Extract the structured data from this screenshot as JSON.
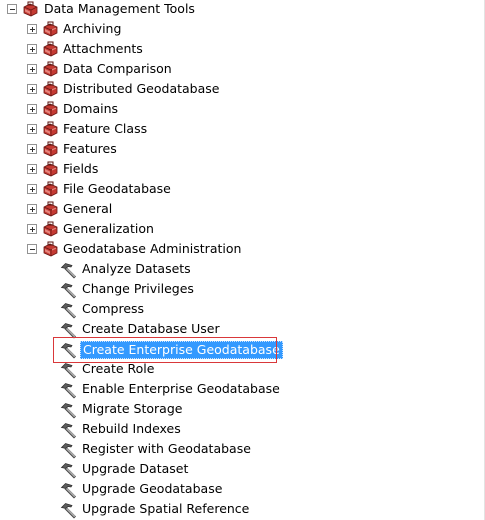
{
  "tree": {
    "root": {
      "label": "Data Management Tools",
      "expanded": true,
      "icon": "toolbox-icon"
    },
    "toolsets": [
      {
        "label": "Archiving",
        "expanded": false,
        "icon": "toolbox-icon"
      },
      {
        "label": "Attachments",
        "expanded": false,
        "icon": "toolbox-icon"
      },
      {
        "label": "Data Comparison",
        "expanded": false,
        "icon": "toolbox-icon"
      },
      {
        "label": "Distributed Geodatabase",
        "expanded": false,
        "icon": "toolbox-icon"
      },
      {
        "label": "Domains",
        "expanded": false,
        "icon": "toolbox-icon"
      },
      {
        "label": "Feature Class",
        "expanded": false,
        "icon": "toolbox-icon"
      },
      {
        "label": "Features",
        "expanded": false,
        "icon": "toolbox-icon"
      },
      {
        "label": "Fields",
        "expanded": false,
        "icon": "toolbox-icon"
      },
      {
        "label": "File Geodatabase",
        "expanded": false,
        "icon": "toolbox-icon"
      },
      {
        "label": "General",
        "expanded": false,
        "icon": "toolbox-icon"
      },
      {
        "label": "Generalization",
        "expanded": false,
        "icon": "toolbox-icon"
      },
      {
        "label": "Geodatabase Administration",
        "expanded": true,
        "icon": "toolbox-icon"
      }
    ],
    "tools": [
      {
        "label": "Analyze Datasets",
        "icon": "hammer-icon",
        "selected": false
      },
      {
        "label": "Change Privileges",
        "icon": "hammer-icon",
        "selected": false
      },
      {
        "label": "Compress",
        "icon": "hammer-icon",
        "selected": false
      },
      {
        "label": "Create Database User",
        "icon": "hammer-icon",
        "selected": false
      },
      {
        "label": "Create Enterprise Geodatabase",
        "icon": "hammer-icon",
        "selected": true
      },
      {
        "label": "Create Role",
        "icon": "hammer-icon",
        "selected": false
      },
      {
        "label": "Enable Enterprise Geodatabase",
        "icon": "hammer-icon",
        "selected": false
      },
      {
        "label": "Migrate Storage",
        "icon": "hammer-icon",
        "selected": false
      },
      {
        "label": "Rebuild Indexes",
        "icon": "hammer-icon",
        "selected": false
      },
      {
        "label": "Register with Geodatabase",
        "icon": "hammer-icon",
        "selected": false
      },
      {
        "label": "Upgrade Dataset",
        "icon": "hammer-icon",
        "selected": false
      },
      {
        "label": "Upgrade Geodatabase",
        "icon": "hammer-icon",
        "selected": false
      },
      {
        "label": "Upgrade Spatial Reference",
        "icon": "hammer-icon",
        "selected": false
      }
    ]
  },
  "colors": {
    "selection_background": "#3399ff",
    "selection_text": "#ffffff",
    "annotation_box": "#d9383a",
    "toolbox_red": "#b8332e"
  }
}
